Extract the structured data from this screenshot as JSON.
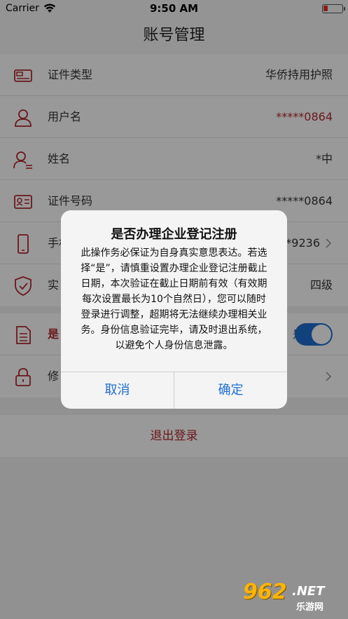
{
  "status_bar": {
    "carrier": "Carrier",
    "time": "9:50 AM"
  },
  "nav": {
    "title": "账号管理"
  },
  "rows_group1": [
    {
      "label": "证件类型",
      "value": "华侨持用护照",
      "icon": "id-card-icon"
    },
    {
      "label": "用户名",
      "value": "*****0864",
      "icon": "user-icon"
    },
    {
      "label": "姓名",
      "value": "*中",
      "icon": "person-name-icon"
    },
    {
      "label": "证件号码",
      "value": "*****0864",
      "icon": "id-number-icon"
    },
    {
      "label": "手机",
      "value": "*9236",
      "icon": "phone-icon"
    },
    {
      "label": "实",
      "value": "四级",
      "icon": "shield-check-icon"
    }
  ],
  "rows_group2": [
    {
      "label": "是",
      "value": "是",
      "icon": "document-icon",
      "toggle_on": true
    },
    {
      "label": "修",
      "value": "",
      "icon": "lock-icon"
    }
  ],
  "logout": {
    "label": "退出登录"
  },
  "alert": {
    "title": "是否办理企业登记注册",
    "message": "此操作务必保证为自身真实意思表达。若选择“是”，请慎重设置办理企业登记注册截止日期，本次验证在截止日期前有效（有效期每次设置最长为10个自然日），您可以随时登录进行调整，超期将无法继续办理相关业务。身份信息验证完毕，请及时退出系统，以避免个人身份信息泄露。",
    "cancel_label": "取消",
    "confirm_label": "确定"
  },
  "watermark": {
    "num": "962",
    "net": ".NET",
    "cn": "乐游网"
  },
  "colors": {
    "accent_red": "#b3282d",
    "ios_blue": "#1f6fd0",
    "battery_red": "#e0312b"
  }
}
